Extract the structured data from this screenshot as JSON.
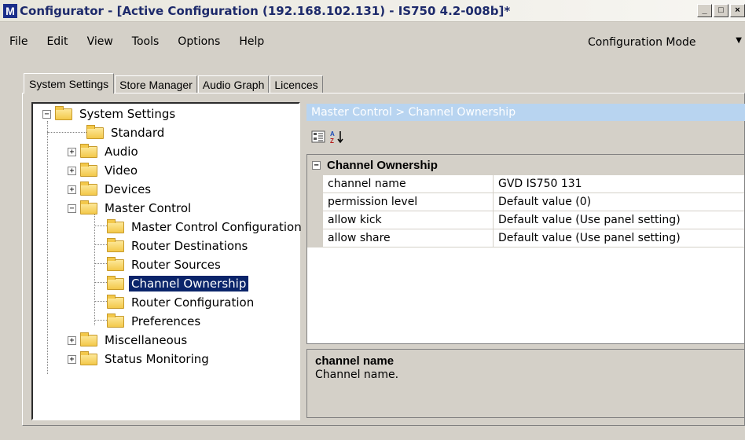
{
  "window": {
    "logo": "M",
    "title": "Configurator - [Active Configuration (192.168.102.131) - IS750 4.2-008b]*",
    "min_label": "_",
    "max_label": "□",
    "close_label": "×"
  },
  "menu": {
    "items": [
      "File",
      "Edit",
      "View",
      "Tools",
      "Options",
      "Help"
    ],
    "mode": "Configuration Mode"
  },
  "tabs": [
    "System Settings",
    "Store Manager",
    "Audio Graph",
    "Licences"
  ],
  "tree": {
    "root": "System Settings",
    "items": [
      {
        "label": "Standard"
      },
      {
        "label": "Audio"
      },
      {
        "label": "Video"
      },
      {
        "label": "Devices"
      },
      {
        "label": "Master Control"
      },
      {
        "label": "Master Control Configuration"
      },
      {
        "label": "Router Destinations"
      },
      {
        "label": "Router Sources"
      },
      {
        "label": "Channel Ownership"
      },
      {
        "label": "Router Configuration"
      },
      {
        "label": "Preferences"
      },
      {
        "label": "Miscellaneous"
      },
      {
        "label": "Status Monitoring"
      }
    ]
  },
  "right_panel": {
    "breadcrumb": "Master Control > Channel Ownership",
    "category": "Channel Ownership",
    "properties": [
      {
        "name": "channel name",
        "value": "GVD IS750 131"
      },
      {
        "name": "permission level",
        "value": "Default value (0)"
      },
      {
        "name": "allow kick",
        "value": "Default value (Use panel setting)"
      },
      {
        "name": "allow share",
        "value": "Default value (Use panel setting)"
      }
    ],
    "description_title": "channel name",
    "description_text": "Channel name."
  },
  "colors": {
    "selection": "#0a246a",
    "header_bg": "#b8d4f0",
    "window_bg": "#d4d0c8"
  },
  "icons": [
    "categorized-view-icon",
    "alphabetical-sort-icon",
    "folder-icon",
    "expand-icon",
    "collapse-icon"
  ]
}
